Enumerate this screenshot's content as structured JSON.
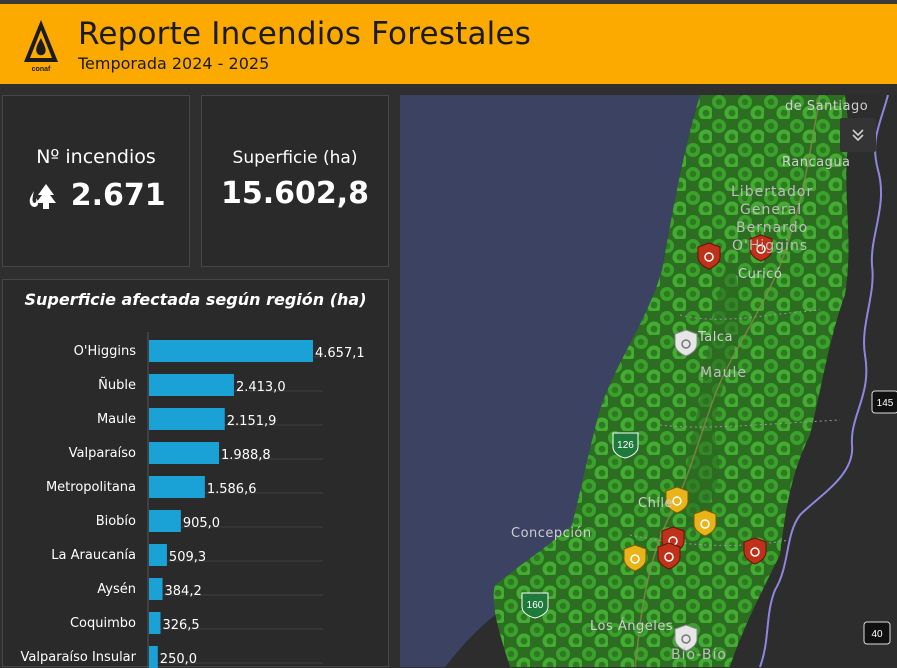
{
  "header": {
    "logo_text": "conaf",
    "title": "Reporte Incendios Forestales",
    "subtitle": "Temporada 2024 - 2025"
  },
  "kpis": {
    "incendios": {
      "label": "Nº incendios",
      "value": "2.671",
      "icon": "forest-fire-icon"
    },
    "superficie": {
      "label": "Superficie (ha)",
      "value": "15.602,8"
    }
  },
  "chart_data": {
    "type": "bar",
    "orientation": "horizontal",
    "title": "Superficie afectada según región (ha)",
    "categories": [
      "O'Higgins",
      "Ñuble",
      "Maule",
      "Valparaíso",
      "Metropolitana",
      "Biobío",
      "La Araucanía",
      "Aysén",
      "Coquimbo",
      "Valparaíso Insular"
    ],
    "values": [
      4657.1,
      2413.0,
      2151.9,
      1988.8,
      1586.6,
      905.0,
      509.3,
      384.2,
      326.5,
      250.0
    ],
    "labels": [
      "4.657,1",
      "2.413,0",
      "2.151,9",
      "1.988,8",
      "1.586,6",
      "905,0",
      "509,3",
      "384,2",
      "326,5",
      "250,0"
    ],
    "xlim": [
      0,
      4657.1
    ],
    "bar_color": "#1aa1d6",
    "grid": true
  },
  "map": {
    "labels": [
      {
        "text": "de Santiago"
      },
      {
        "text": "Rancagua"
      },
      {
        "text": "Libertador"
      },
      {
        "text": "General"
      },
      {
        "text": "Bernardo"
      },
      {
        "text": "O'Higgins"
      },
      {
        "text": "Curicó"
      },
      {
        "text": "Talca"
      },
      {
        "text": "Maule"
      },
      {
        "text": "Chile"
      },
      {
        "text": "Concepción"
      },
      {
        "text": "Los Ángeles"
      },
      {
        "text": "Bío-Bío"
      }
    ],
    "shields": {
      "r126": "126",
      "r160": "160",
      "r145": "145",
      "r40": "40"
    },
    "colors": {
      "ocean": "#3b4262",
      "land": "#2d2d2d",
      "fire_green": "#3fa62f",
      "fire_red": "#c0311a",
      "fire_yellow": "#e8b41a",
      "fire_white": "#e6e6e6",
      "border": "#8f86e0"
    }
  },
  "controls": {
    "collapse_icon": "chevron-double-down-icon"
  }
}
